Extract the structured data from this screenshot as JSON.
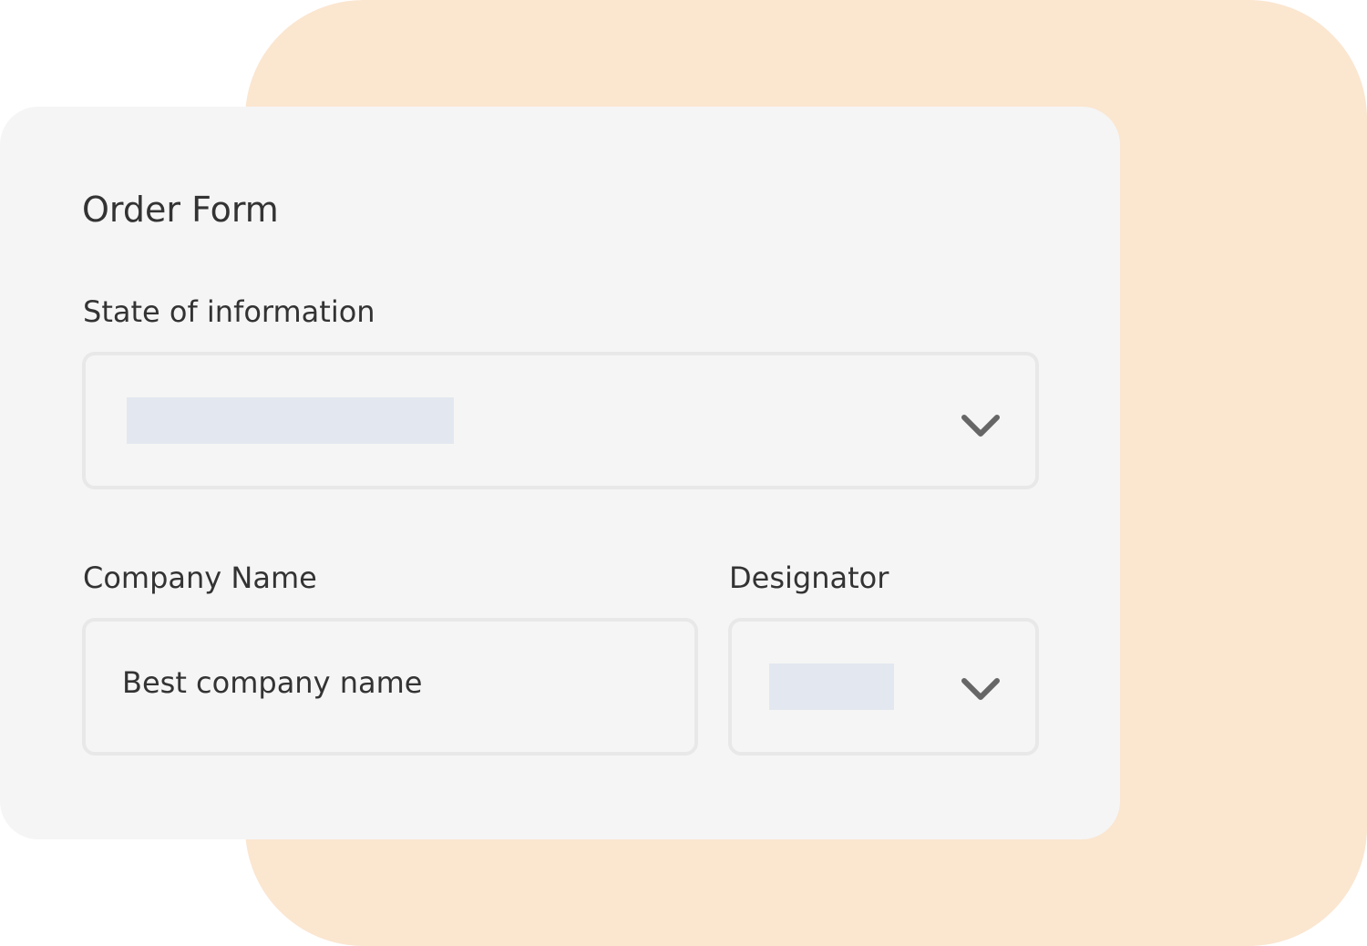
{
  "form": {
    "title": "Order Form",
    "state_field": {
      "label": "State of information",
      "value": ""
    },
    "company_field": {
      "label": "Company Name",
      "value": "Best company name"
    },
    "designator_field": {
      "label": "Designator",
      "value": ""
    }
  },
  "icons": {
    "dropdown": "chevron-down-icon"
  },
  "colors": {
    "background_shape": "#fbe6d0",
    "card": "#f5f5f5",
    "field_border": "#e8e8e8",
    "placeholder": "#e3e7ef",
    "text": "#333333",
    "icon": "#666666"
  }
}
